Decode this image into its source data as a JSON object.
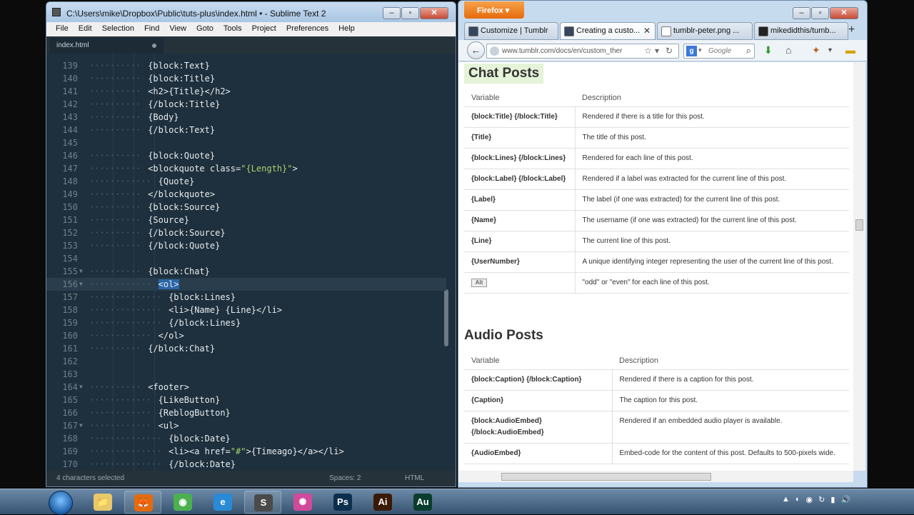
{
  "sublime": {
    "title": "C:\\Users\\mike\\Dropbox\\Public\\tuts-plus\\index.html • - Sublime Text 2",
    "menu": [
      "File",
      "Edit",
      "Selection",
      "Find",
      "View",
      "Goto",
      "Tools",
      "Project",
      "Preferences",
      "Help"
    ],
    "tab_label": "index.html",
    "status_left": "4 characters selected",
    "status_spaces": "Spaces: 2",
    "status_syntax": "HTML",
    "lines": [
      {
        "n": "139",
        "indent": 5,
        "text": "{block:Text}"
      },
      {
        "n": "140",
        "indent": 5,
        "text": "{block:Title}"
      },
      {
        "n": "141",
        "indent": 5,
        "text": "<h2>{Title}</h2>"
      },
      {
        "n": "142",
        "indent": 5,
        "text": "{/block:Title}"
      },
      {
        "n": "143",
        "indent": 5,
        "text": "{Body}"
      },
      {
        "n": "144",
        "indent": 5,
        "text": "{/block:Text}"
      },
      {
        "n": "145",
        "indent": 0,
        "text": ""
      },
      {
        "n": "146",
        "indent": 5,
        "text": "{block:Quote}"
      },
      {
        "n": "147",
        "indent": 5,
        "text": "<blockquote class=\"{Length}\">"
      },
      {
        "n": "148",
        "indent": 6,
        "text": "{Quote}"
      },
      {
        "n": "149",
        "indent": 5,
        "text": "</blockquote>"
      },
      {
        "n": "150",
        "indent": 5,
        "text": "{block:Source}"
      },
      {
        "n": "151",
        "indent": 5,
        "text": "{Source}"
      },
      {
        "n": "152",
        "indent": 5,
        "text": "{/block:Source}"
      },
      {
        "n": "153",
        "indent": 5,
        "text": "{/block:Quote}"
      },
      {
        "n": "154",
        "indent": 0,
        "text": ""
      },
      {
        "n": "155",
        "indent": 5,
        "text": "{block:Chat}",
        "fold": true
      },
      {
        "n": "156",
        "indent": 6,
        "text": "<ol>",
        "fold": true,
        "active": true,
        "selected": true
      },
      {
        "n": "157",
        "indent": 7,
        "text": "{block:Lines}"
      },
      {
        "n": "158",
        "indent": 7,
        "text": "<li>{Name} {Line}</li>"
      },
      {
        "n": "159",
        "indent": 7,
        "text": "{/block:Lines}"
      },
      {
        "n": "160",
        "indent": 6,
        "text": "</ol>"
      },
      {
        "n": "161",
        "indent": 5,
        "text": "{/block:Chat}"
      },
      {
        "n": "162",
        "indent": 0,
        "text": ""
      },
      {
        "n": "163",
        "indent": 0,
        "text": ""
      },
      {
        "n": "164",
        "indent": 5,
        "text": "<footer>",
        "fold": true
      },
      {
        "n": "165",
        "indent": 6,
        "text": "{LikeButton}"
      },
      {
        "n": "166",
        "indent": 6,
        "text": "{ReblogButton}"
      },
      {
        "n": "167",
        "indent": 6,
        "text": "<ul>",
        "fold": true
      },
      {
        "n": "168",
        "indent": 7,
        "text": "{block:Date}"
      },
      {
        "n": "169",
        "indent": 7,
        "text": "<li><a href=\"#\">{Timeago}</a></li>"
      },
      {
        "n": "170",
        "indent": 7,
        "text": "{/block:Date}"
      }
    ]
  },
  "firefox": {
    "menu_button": "Firefox",
    "tabs": [
      {
        "label": "Customize | Tumblr",
        "icon_color": "#36465d"
      },
      {
        "label": "Creating a custo...",
        "icon_color": "#36465d"
      },
      {
        "label": "tumblr-peter.png ...",
        "icon_color": "#ffffff"
      },
      {
        "label": "mikedidthis/tumb...",
        "icon_color": "#222222"
      }
    ],
    "url": "www.tumblr.com/docs/en/custom_ther",
    "search_placeholder": "Google",
    "chat_heading": "Chat Posts",
    "audio_heading": "Audio Posts",
    "col_variable": "Variable",
    "col_description": "Description",
    "chat_rows": [
      {
        "var": "{block:Title} {/block:Title}",
        "desc": "Rendered if there is a title for this post."
      },
      {
        "var": "{Title}",
        "desc": "The title of this post."
      },
      {
        "var": "{block:Lines} {/block:Lines}",
        "desc": "Rendered for each line of this post."
      },
      {
        "var": "{block:Label} {/block:Label}",
        "desc": "Rendered if a label was extracted for the current line of this post."
      },
      {
        "var": "{Label}",
        "desc": "The label (if one was extracted) for the current line of this post."
      },
      {
        "var": "{Name}",
        "desc": "The username (if one was extracted) for the current line of this post."
      },
      {
        "var": "{Line}",
        "desc": "The current line of this post."
      },
      {
        "var": "{UserNumber}",
        "desc": "A unique identifying integer representing the user of the current line of this post."
      },
      {
        "var": "{Alt}",
        "desc": "\"odd\" or \"even\" for each line of this post."
      }
    ],
    "audio_rows": [
      {
        "var": "{block:Caption} {/block:Caption}",
        "desc": "Rendered if there is a caption for this post."
      },
      {
        "var": "{Caption}",
        "desc": "The caption for this post."
      },
      {
        "var": "{block:AudioEmbed} {/block:AudioEmbed}",
        "desc": "Rendered if an embedded audio player is available."
      },
      {
        "var": "{AudioEmbed}",
        "desc": "Embed-code for the content of this post. Defaults to 500-pixels wide."
      }
    ]
  },
  "taskbar": {
    "apps": [
      {
        "name": "explorer-icon",
        "glyph": "📁",
        "bg": "#e8c86a",
        "running": false
      },
      {
        "name": "firefox-icon",
        "glyph": "🦊",
        "bg": "#e66a0b",
        "running": true
      },
      {
        "name": "chrome-icon",
        "glyph": "◉",
        "bg": "#4caf50",
        "running": false
      },
      {
        "name": "ie-icon",
        "glyph": "e",
        "bg": "#2a8ad6",
        "running": false
      },
      {
        "name": "sublime-icon",
        "glyph": "S",
        "bg": "#4a4a4a",
        "running": true
      },
      {
        "name": "color-wheel-icon",
        "glyph": "✺",
        "bg": "#d04a9a",
        "running": false
      },
      {
        "name": "photoshop-icon",
        "glyph": "Ps",
        "bg": "#0b2f4d",
        "running": false
      },
      {
        "name": "illustrator-icon",
        "glyph": "Ai",
        "bg": "#3a1a05",
        "running": false
      },
      {
        "name": "audition-icon",
        "glyph": "Au",
        "bg": "#0a3d2e",
        "running": false
      }
    ]
  }
}
